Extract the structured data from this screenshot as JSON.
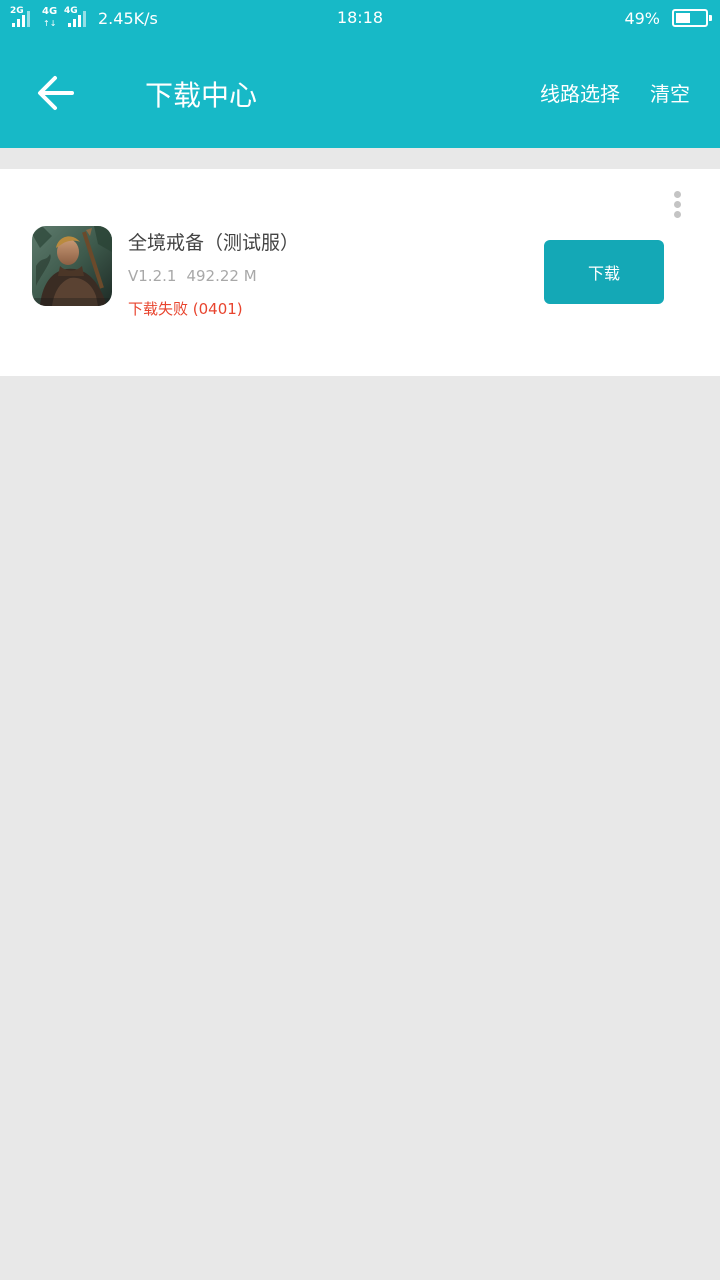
{
  "status_bar": {
    "sim1_label": "2G",
    "sim2_label": "4G",
    "sim3_label": "4G",
    "net_speed": "2.45K/s",
    "time": "18:18",
    "battery_pct": "49%",
    "battery_level": 0.49
  },
  "header": {
    "back_icon": "arrow-left-icon",
    "title": "下载中心",
    "route_label": "线路选择",
    "clear_label": "清空"
  },
  "download_item": {
    "name": "全境戒备（测试服）",
    "version": "V1.2.1",
    "size": "492.22 M",
    "status": "下载失败 (0401)",
    "button_label": "下载",
    "more_icon": "more-vertical-icon"
  },
  "colors": {
    "accent": "#17b9c7",
    "button": "#14a8b6",
    "error": "#e8442e",
    "background": "#e8e8e8"
  }
}
